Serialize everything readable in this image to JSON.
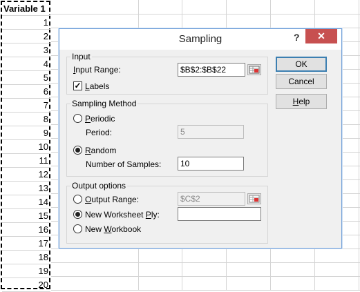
{
  "sheet": {
    "header": "Variable 1",
    "rows": [
      "1",
      "2",
      "3",
      "4",
      "5",
      "6",
      "7",
      "8",
      "9",
      "10",
      "11",
      "12",
      "13",
      "14",
      "15",
      "16",
      "17",
      "18",
      "19",
      "20"
    ]
  },
  "dialog": {
    "title": "Sampling",
    "help_glyph": "?",
    "close_glyph": "✕",
    "input": {
      "group_label": "Input",
      "input_range_label": "Input Range:",
      "input_range_value": "$B$2:$B$22",
      "labels_label": "Labels",
      "labels_checked": true
    },
    "sampling": {
      "group_label": "Sampling Method",
      "periodic_label": "Periodic",
      "period_label": "Period:",
      "period_value": "5",
      "random_label": "Random",
      "samples_label": "Number of Samples:",
      "samples_value": "10"
    },
    "output": {
      "group_label": "Output options",
      "output_range_label": "Output Range:",
      "output_range_value": "$C$2",
      "new_ply_label": "New Worksheet Ply:",
      "new_ply_value": "",
      "new_workbook_label": "New Workbook"
    },
    "buttons": {
      "ok": "OK",
      "cancel": "Cancel",
      "help": "Help"
    }
  }
}
